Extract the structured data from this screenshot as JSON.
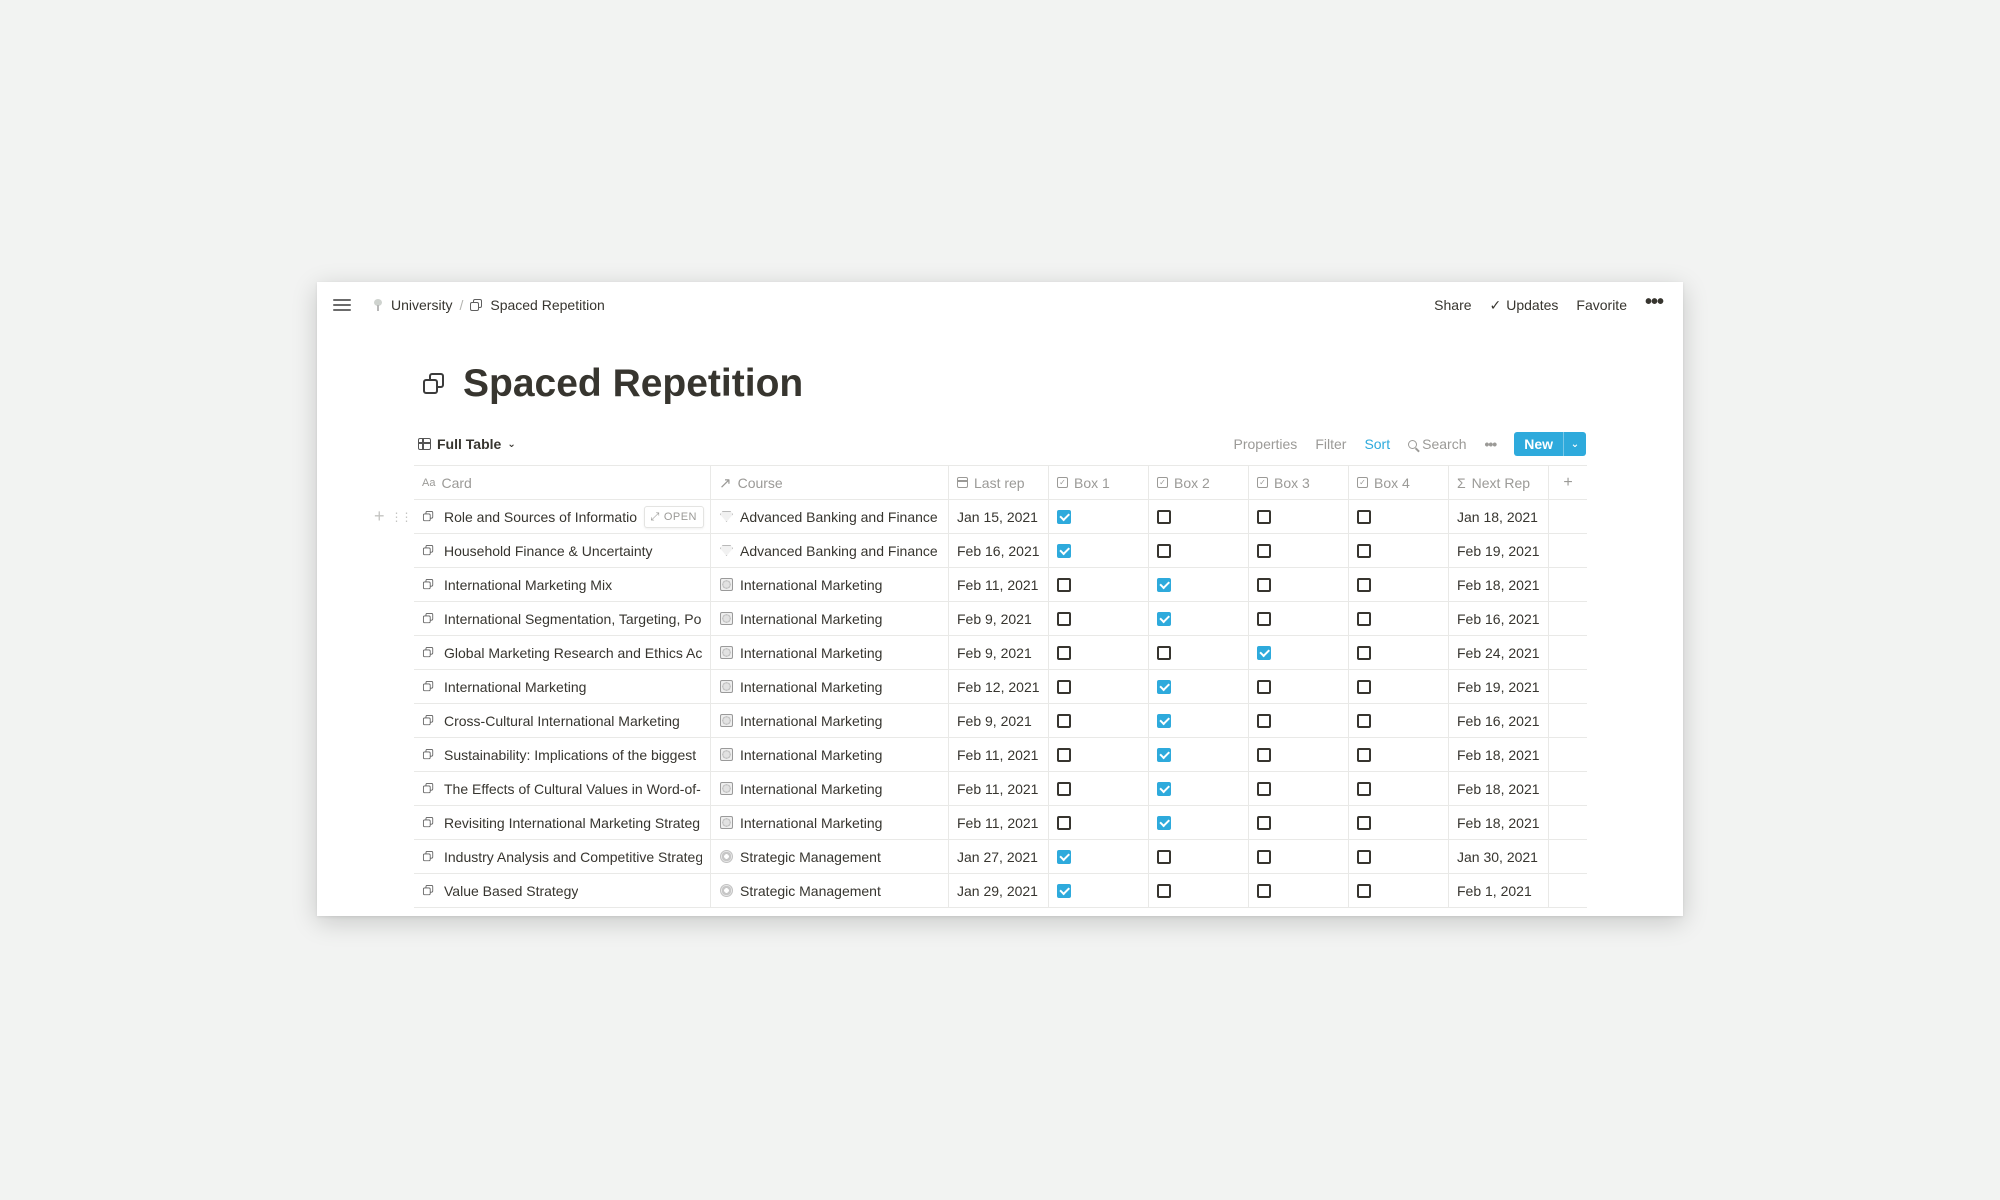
{
  "breadcrumb": {
    "items": [
      {
        "label": "University",
        "icon": "tree-icon"
      },
      {
        "label": "Spaced Repetition",
        "icon": "stack-icon"
      }
    ],
    "separator": "/"
  },
  "topbar": {
    "share_label": "Share",
    "updates_label": "Updates",
    "favorite_label": "Favorite",
    "more_label": "•••"
  },
  "page": {
    "title": "Spaced Repetition",
    "icon": "stack-icon"
  },
  "view": {
    "name": "Full Table",
    "properties_label": "Properties",
    "filter_label": "Filter",
    "sort_label": "Sort",
    "search_label": "Search",
    "more_label": "•••",
    "new_label": "New"
  },
  "colors": {
    "accent": "#2eaadc",
    "text": "#37352f",
    "muted": "#9b9a97",
    "background": "#f2f3f2"
  },
  "table": {
    "columns": [
      {
        "label": "Card",
        "icon": "text-property-icon"
      },
      {
        "label": "Course",
        "icon": "relation-arrow-icon"
      },
      {
        "label": "Last rep",
        "icon": "calendar-icon"
      },
      {
        "label": "Box 1",
        "icon": "checkbox-property-icon"
      },
      {
        "label": "Box 2",
        "icon": "checkbox-property-icon"
      },
      {
        "label": "Box 3",
        "icon": "checkbox-property-icon"
      },
      {
        "label": "Box 4",
        "icon": "checkbox-property-icon"
      },
      {
        "label": "Next Rep",
        "icon": "formula-sigma-icon"
      }
    ],
    "open_label": "OPEN",
    "rows": [
      {
        "card": "Role and Sources of Informatio",
        "course": "Advanced Banking and Finance",
        "course_icon": "gem",
        "last_rep": "Jan 15, 2021",
        "boxes": [
          true,
          false,
          false,
          false
        ],
        "next_rep": "Jan 18, 2021"
      },
      {
        "card": "Household Finance & Uncertainty",
        "course": "Advanced Banking and Finance",
        "course_icon": "gem",
        "last_rep": "Feb 16, 2021",
        "boxes": [
          true,
          false,
          false,
          false
        ],
        "next_rep": "Feb 19, 2021"
      },
      {
        "card": "International Marketing Mix",
        "course": "International Marketing",
        "course_icon": "globe",
        "last_rep": "Feb 11, 2021",
        "boxes": [
          false,
          true,
          false,
          false
        ],
        "next_rep": "Feb 18, 2021"
      },
      {
        "card": "International Segmentation, Targeting, Po",
        "course": "International Marketing",
        "course_icon": "globe",
        "last_rep": "Feb 9, 2021",
        "boxes": [
          false,
          true,
          false,
          false
        ],
        "next_rep": "Feb 16, 2021"
      },
      {
        "card": "Global Marketing Research and Ethics Acr",
        "course": "International Marketing",
        "course_icon": "globe",
        "last_rep": "Feb 9, 2021",
        "boxes": [
          false,
          false,
          true,
          false
        ],
        "next_rep": "Feb 24, 2021"
      },
      {
        "card": "International Marketing",
        "course": "International Marketing",
        "course_icon": "globe",
        "last_rep": "Feb 12, 2021",
        "boxes": [
          false,
          true,
          false,
          false
        ],
        "next_rep": "Feb 19, 2021"
      },
      {
        "card": "Cross-Cultural International Marketing",
        "course": "International Marketing",
        "course_icon": "globe",
        "last_rep": "Feb 9, 2021",
        "boxes": [
          false,
          true,
          false,
          false
        ],
        "next_rep": "Feb 16, 2021"
      },
      {
        "card": "Sustainability: Implications of the biggest",
        "course": "International Marketing",
        "course_icon": "globe",
        "last_rep": "Feb 11, 2021",
        "boxes": [
          false,
          true,
          false,
          false
        ],
        "next_rep": "Feb 18, 2021"
      },
      {
        "card": "The Effects of Cultural Values in Word-of-I",
        "course": "International Marketing",
        "course_icon": "globe",
        "last_rep": "Feb 11, 2021",
        "boxes": [
          false,
          true,
          false,
          false
        ],
        "next_rep": "Feb 18, 2021"
      },
      {
        "card": "Revisiting International Marketing Strateg",
        "course": "International Marketing",
        "course_icon": "globe",
        "last_rep": "Feb 11, 2021",
        "boxes": [
          false,
          true,
          false,
          false
        ],
        "next_rep": "Feb 18, 2021"
      },
      {
        "card": "Industry Analysis and Competitive Strateg",
        "course": "Strategic Management",
        "course_icon": "lab",
        "last_rep": "Jan 27, 2021",
        "boxes": [
          true,
          false,
          false,
          false
        ],
        "next_rep": "Jan 30, 2021"
      },
      {
        "card": "Value Based Strategy",
        "course": "Strategic Management",
        "course_icon": "lab",
        "last_rep": "Jan 29, 2021",
        "boxes": [
          true,
          false,
          false,
          false
        ],
        "next_rep": "Feb 1, 2021"
      }
    ]
  }
}
